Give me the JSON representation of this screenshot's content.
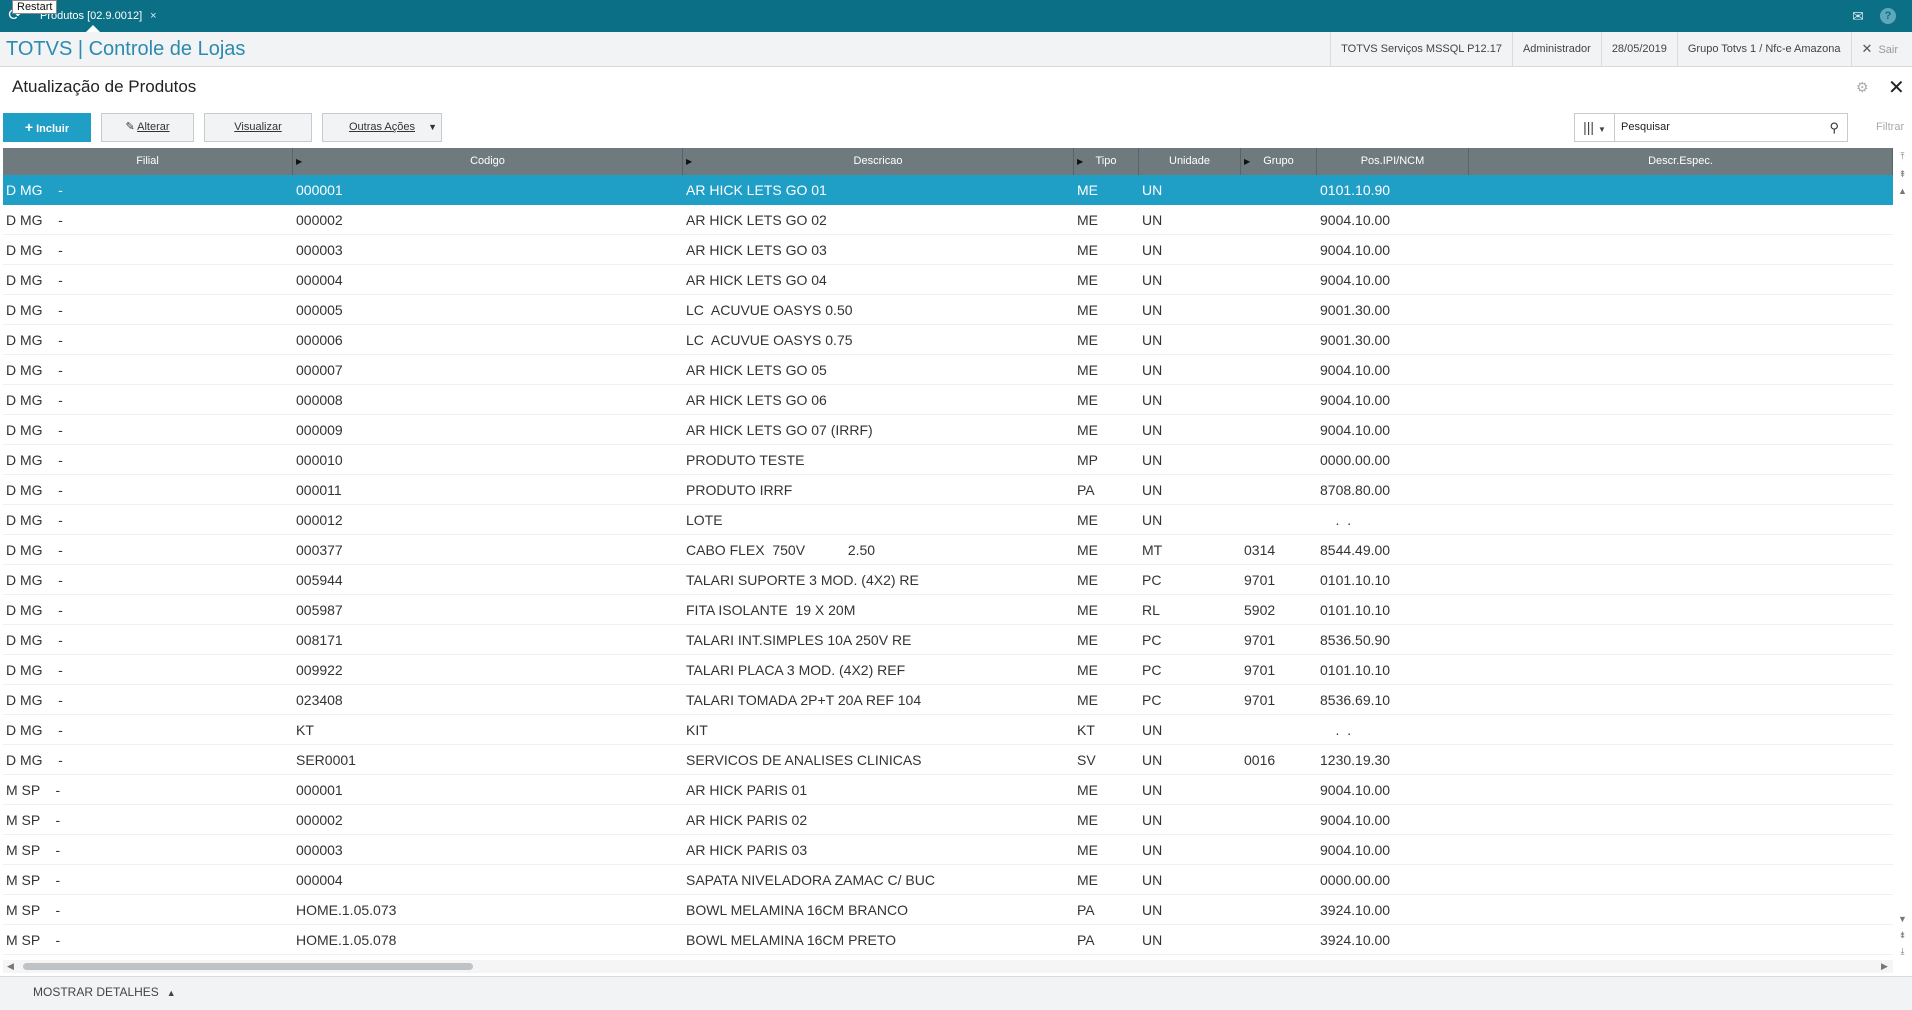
{
  "topbar": {
    "tooltip": "Restart",
    "tab_label": "Produtos [02.9.0012]",
    "tab_close": "×",
    "refresh_icon": "⟳",
    "mail_icon": "✉",
    "help_icon": "?"
  },
  "titlebar": {
    "app_title": "TOTVS | Controle de Lojas",
    "service": "TOTVS Serviços MSSQL P12.17",
    "user": "Administrador",
    "date": "28/05/2019",
    "group": "Grupo Totvs 1 / Nfc-e  Amazona",
    "exit_label": "Sair"
  },
  "page": {
    "title": "Atualização de Produtos"
  },
  "toolbar": {
    "include_label": "Incluir",
    "edit_label": "Alterar",
    "view_label": "Visualizar",
    "more_label": "Outras Ações",
    "search_placeholder": "Pesquisar",
    "filter_label": "Filtrar"
  },
  "grid": {
    "columns": [
      "Filial",
      "Codigo",
      "Descricao",
      "Tipo",
      "Unidade",
      "Grupo",
      "Pos.IPI/NCM",
      "Descr.Espec."
    ],
    "rows": [
      {
        "filial": "D MG    -",
        "codigo": "000001",
        "descricao": "AR HICK LETS GO 01",
        "tipo": "ME",
        "unidade": "UN",
        "grupo": "",
        "ncm": "0101.10.90"
      },
      {
        "filial": "D MG    -",
        "codigo": "000002",
        "descricao": "AR HICK LETS GO 02",
        "tipo": "ME",
        "unidade": "UN",
        "grupo": "",
        "ncm": "9004.10.00"
      },
      {
        "filial": "D MG    -",
        "codigo": "000003",
        "descricao": "AR HICK LETS GO 03",
        "tipo": "ME",
        "unidade": "UN",
        "grupo": "",
        "ncm": "9004.10.00"
      },
      {
        "filial": "D MG    -",
        "codigo": "000004",
        "descricao": "AR HICK LETS GO 04",
        "tipo": "ME",
        "unidade": "UN",
        "grupo": "",
        "ncm": "9004.10.00"
      },
      {
        "filial": "D MG    -",
        "codigo": "000005",
        "descricao": "LC  ACUVUE OASYS 0.50",
        "tipo": "ME",
        "unidade": "UN",
        "grupo": "",
        "ncm": "9001.30.00"
      },
      {
        "filial": "D MG    -",
        "codigo": "000006",
        "descricao": "LC  ACUVUE OASYS 0.75",
        "tipo": "ME",
        "unidade": "UN",
        "grupo": "",
        "ncm": "9001.30.00"
      },
      {
        "filial": "D MG    -",
        "codigo": "000007",
        "descricao": "AR HICK LETS GO 05",
        "tipo": "ME",
        "unidade": "UN",
        "grupo": "",
        "ncm": "9004.10.00"
      },
      {
        "filial": "D MG    -",
        "codigo": "000008",
        "descricao": "AR HICK LETS GO 06",
        "tipo": "ME",
        "unidade": "UN",
        "grupo": "",
        "ncm": "9004.10.00"
      },
      {
        "filial": "D MG    -",
        "codigo": "000009",
        "descricao": "AR HICK LETS GO 07 (IRRF)",
        "tipo": "ME",
        "unidade": "UN",
        "grupo": "",
        "ncm": "9004.10.00"
      },
      {
        "filial": "D MG    -",
        "codigo": "000010",
        "descricao": "PRODUTO TESTE",
        "tipo": "MP",
        "unidade": "UN",
        "grupo": "",
        "ncm": "0000.00.00"
      },
      {
        "filial": "D MG    -",
        "codigo": "000011",
        "descricao": "PRODUTO IRRF",
        "tipo": "PA",
        "unidade": "UN",
        "grupo": "",
        "ncm": "8708.80.00"
      },
      {
        "filial": "D MG    -",
        "codigo": "000012",
        "descricao": "LOTE",
        "tipo": "ME",
        "unidade": "UN",
        "grupo": "",
        "ncm": "    .  ."
      },
      {
        "filial": "D MG    -",
        "codigo": "000377",
        "descricao": "CABO FLEX  750V           2.50",
        "tipo": "ME",
        "unidade": "MT",
        "grupo": "0314",
        "ncm": "8544.49.00"
      },
      {
        "filial": "D MG    -",
        "codigo": "005944",
        "descricao": "TALARI SUPORTE 3 MOD. (4X2) RE",
        "tipo": "ME",
        "unidade": "PC",
        "grupo": "9701",
        "ncm": "0101.10.10"
      },
      {
        "filial": "D MG    -",
        "codigo": "005987",
        "descricao": "FITA ISOLANTE  19 X 20M",
        "tipo": "ME",
        "unidade": "RL",
        "grupo": "5902",
        "ncm": "0101.10.10"
      },
      {
        "filial": "D MG    -",
        "codigo": "008171",
        "descricao": "TALARI INT.SIMPLES 10A 250V RE",
        "tipo": "ME",
        "unidade": "PC",
        "grupo": "9701",
        "ncm": "8536.50.90"
      },
      {
        "filial": "D MG    -",
        "codigo": "009922",
        "descricao": "TALARI PLACA 3 MOD. (4X2) REF",
        "tipo": "ME",
        "unidade": "PC",
        "grupo": "9701",
        "ncm": "0101.10.10"
      },
      {
        "filial": "D MG    -",
        "codigo": "023408",
        "descricao": "TALARI TOMADA 2P+T 20A REF 104",
        "tipo": "ME",
        "unidade": "PC",
        "grupo": "9701",
        "ncm": "8536.69.10"
      },
      {
        "filial": "D MG    -",
        "codigo": "KT",
        "descricao": "KIT",
        "tipo": "KT",
        "unidade": "UN",
        "grupo": "",
        "ncm": "    .  ."
      },
      {
        "filial": "D MG    -",
        "codigo": "SER0001",
        "descricao": "SERVICOS DE ANALISES CLINICAS",
        "tipo": "SV",
        "unidade": "UN",
        "grupo": "0016",
        "ncm": "1230.19.30"
      },
      {
        "filial": "M SP    -",
        "codigo": "000001",
        "descricao": "AR HICK PARIS 01",
        "tipo": "ME",
        "unidade": "UN",
        "grupo": "",
        "ncm": "9004.10.00"
      },
      {
        "filial": "M SP    -",
        "codigo": "000002",
        "descricao": "AR HICK PARIS 02",
        "tipo": "ME",
        "unidade": "UN",
        "grupo": "",
        "ncm": "9004.10.00"
      },
      {
        "filial": "M SP    -",
        "codigo": "000003",
        "descricao": "AR HICK PARIS 03",
        "tipo": "ME",
        "unidade": "UN",
        "grupo": "",
        "ncm": "9004.10.00"
      },
      {
        "filial": "M SP    -",
        "codigo": "000004",
        "descricao": "SAPATA NIVELADORA ZAMAC C/ BUC",
        "tipo": "ME",
        "unidade": "UN",
        "grupo": "",
        "ncm": "0000.00.00"
      },
      {
        "filial": "M SP    -",
        "codigo": "HOME.1.05.073",
        "descricao": "BOWL MELAMINA 16CM BRANCO",
        "tipo": "PA",
        "unidade": "UN",
        "grupo": "",
        "ncm": "3924.10.00"
      },
      {
        "filial": "M SP    -",
        "codigo": "HOME.1.05.078",
        "descricao": "BOWL MELAMINA 16CM PRETO",
        "tipo": "PA",
        "unidade": "UN",
        "grupo": "",
        "ncm": "3924.10.00"
      }
    ],
    "selected_row": 0
  },
  "footer": {
    "details_label": "MOSTRAR DETALHES"
  },
  "colors": {
    "topbar": "#0b6f86",
    "accent": "#1f9ec6",
    "header": "#6f7a7f"
  }
}
